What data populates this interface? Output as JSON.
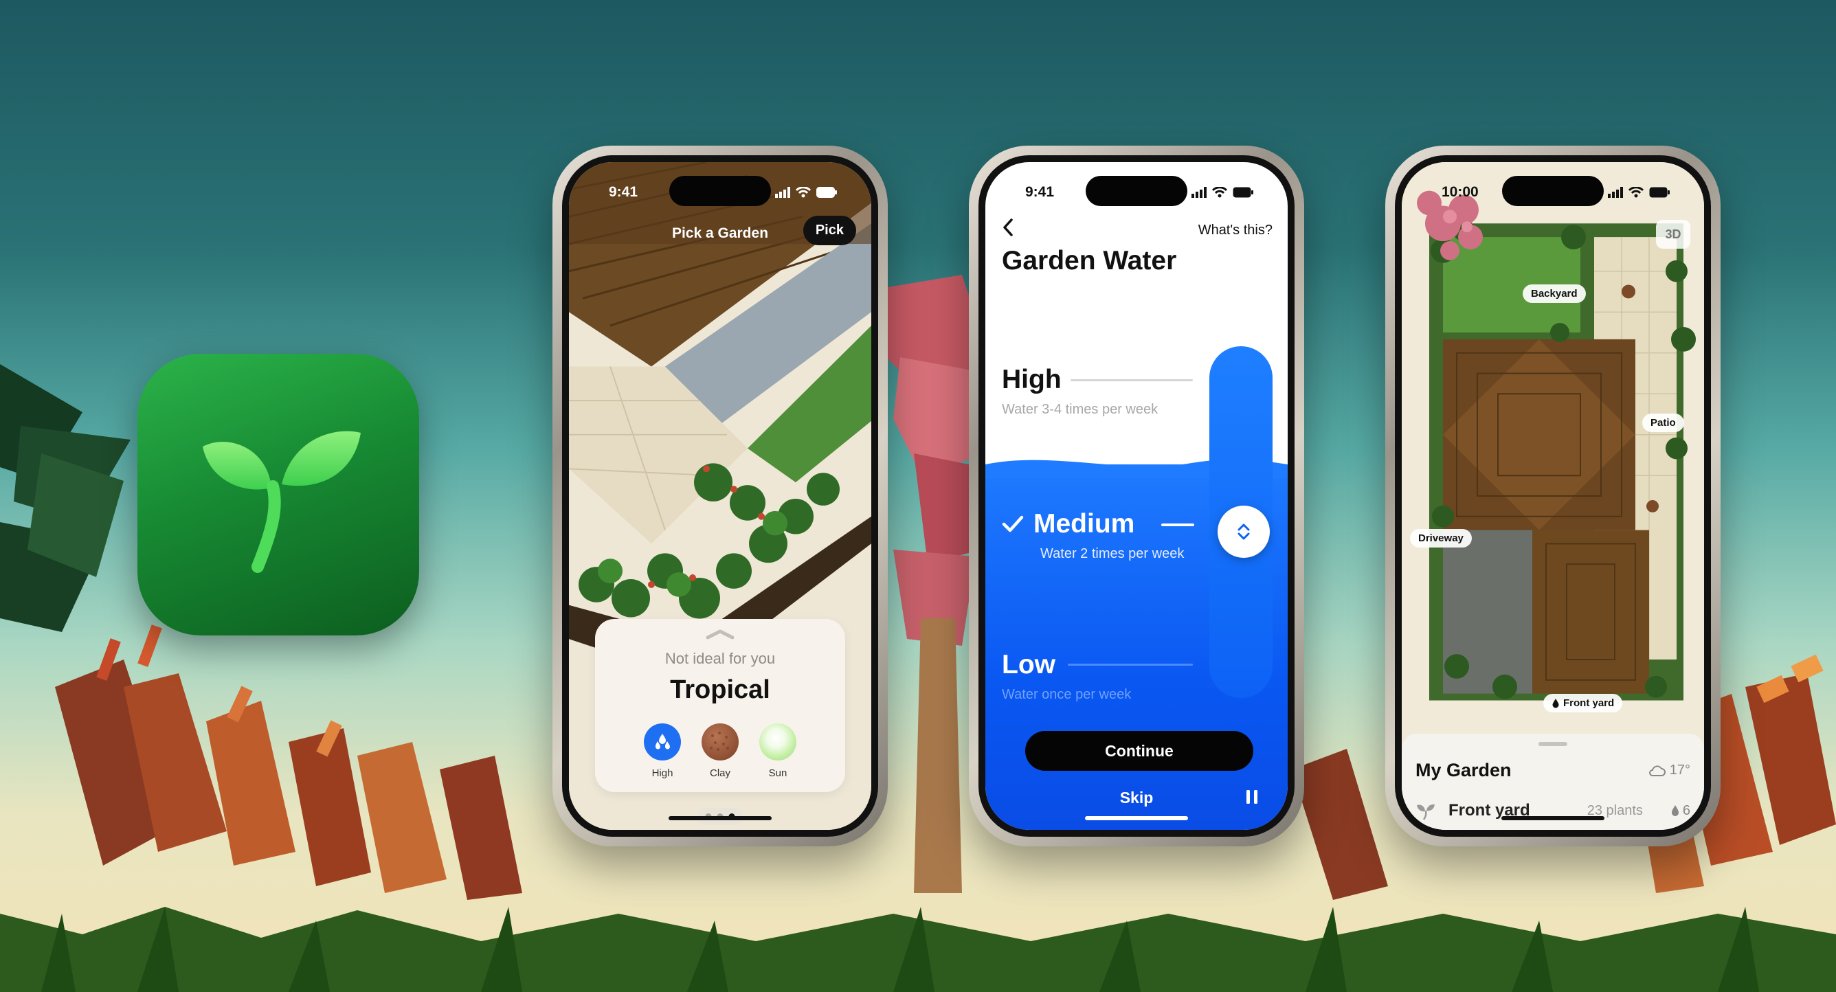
{
  "phone1": {
    "status_time": "9:41",
    "title": "Pick a Garden",
    "pick_button": "Pick",
    "card": {
      "subtitle": "Not ideal for you",
      "title": "Tropical",
      "attributes": [
        {
          "label": "High",
          "icon": "water-drops-icon",
          "color": "#1f6ff2"
        },
        {
          "label": "Clay",
          "icon": "clay-soil-icon",
          "color": "#9a5c3e"
        },
        {
          "label": "Sun",
          "icon": "sun-icon",
          "color": "#c6f0a8"
        }
      ]
    },
    "page_dots": {
      "count": 3,
      "active_index": 2
    }
  },
  "phone2": {
    "status_time": "9:41",
    "whats_this": "What's this?",
    "title": "Garden Water",
    "levels": {
      "high": {
        "name": "High",
        "desc": "Water 3-4 times per week"
      },
      "medium": {
        "name": "Medium",
        "desc": "Water 2 times per week",
        "selected": true
      },
      "low": {
        "name": "Low",
        "desc": "Water once per week"
      }
    },
    "continue_button": "Continue",
    "skip_button": "Skip",
    "accent": "#0a57f2"
  },
  "phone3": {
    "status_time": "10:00",
    "view_toggle": "3D",
    "map_labels": {
      "backyard": "Backyard",
      "patio": "Patio",
      "driveway": "Driveway",
      "front_yard": "Front yard"
    },
    "sheet": {
      "title": "My Garden",
      "temperature": "17°",
      "yard": {
        "name": "Front yard",
        "plants": "23 plants",
        "water": "6"
      }
    }
  },
  "app_icon": {
    "icon": "sprout-icon",
    "color": "#1f9a3c"
  }
}
